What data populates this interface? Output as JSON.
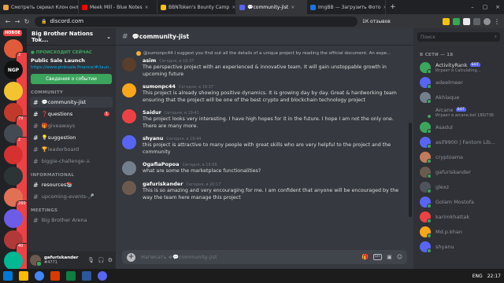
{
  "browser": {
    "tabs": [
      {
        "title": "Смотреть сериал Клон онл",
        "color": "#e8a33d",
        "active": false
      },
      {
        "title": "Meek Mill - Blue Notes",
        "color": "#ff0000",
        "active": false
      },
      {
        "title": "BBNToken's Bounty Camp",
        "color": "#f4c20d",
        "active": false
      },
      {
        "title": "💬community-jist",
        "color": "#5865f2",
        "active": true
      },
      {
        "title": "ImgBB — Загрузить Фото",
        "color": "#1a73e8",
        "active": false
      }
    ],
    "url": "discord.com",
    "reviews": "1К отзывов"
  },
  "guilds": {
    "new_label": "НОВОЕ",
    "items": [
      {
        "label": "",
        "color": "#e15b3a",
        "badge": "2"
      },
      {
        "label": "NGP",
        "color": "#111111",
        "badge": ""
      },
      {
        "label": "",
        "color": "#f4c430",
        "badge": ""
      },
      {
        "label": "",
        "color": "#c0392b",
        "badge": "79"
      },
      {
        "label": "",
        "color": "#444a52",
        "badge": "2"
      },
      {
        "label": "",
        "color": "#d63031",
        "badge": ""
      },
      {
        "label": "",
        "color": "#2d3436",
        "badge": ""
      },
      {
        "label": "",
        "color": "#e17055",
        "badge": "280"
      },
      {
        "label": "",
        "color": "#6c5ce7",
        "badge": ""
      },
      {
        "label": "",
        "color": "#b33939",
        "badge": "40"
      },
      {
        "label": "",
        "color": "#00b894",
        "badge": ""
      }
    ]
  },
  "server": {
    "name": "Big Brother Nations Tok...",
    "event": {
      "live": "● ПРОИСХОДИТ СЕЙЧАС",
      "title": "Public Sale Launch",
      "link": "https://www.pinksale.finance/#/laun...",
      "button": "Сведения о событии"
    },
    "categories": [
      {
        "name": "COMMUNITY",
        "channels": [
          {
            "name": "💬community-jist",
            "state": "active",
            "badge": ""
          },
          {
            "name": "❓questions",
            "state": "unread",
            "badge": "1"
          },
          {
            "name": "🎁giveaways",
            "state": "normal",
            "badge": ""
          },
          {
            "name": "💡suggestion",
            "state": "unread",
            "badge": ""
          },
          {
            "name": "🏆leaderboard",
            "state": "normal",
            "badge": ""
          },
          {
            "name": "biggie-challenge-⚔",
            "state": "normal",
            "badge": ""
          }
        ]
      },
      {
        "name": "INFORMATIONAL",
        "channels": [
          {
            "name": "resources📚",
            "state": "unread",
            "badge": ""
          },
          {
            "name": "upcoming-events-🎤",
            "state": "normal",
            "badge": ""
          }
        ]
      },
      {
        "name": "MEETINGS",
        "channels": [
          {
            "name": "Big Brother Arena",
            "state": "normal",
            "badge": ""
          }
        ]
      }
    ]
  },
  "user": {
    "name": "gafuriskander",
    "tag": "#4771"
  },
  "chat": {
    "channel": "💬community-jist",
    "reply_preview": "@sumonpc44 I suggest you find out all the details of a unique project by reading the official document. An expe...",
    "messages": [
      {
        "author": "asim",
        "time": "Сегодня, в 19:37",
        "color": "#5a3d2b",
        "text": "The perspective project with an experienced & innovative team. It will gain unstoppable growth in upcoming future"
      },
      {
        "author": "sumonpc44",
        "time": "Сегодня, в 19:37",
        "color": "#faa61a",
        "text": "This project is already showing positive dynamics. It is growing day by day. Great & hardworking team ensuring that the project will be one of the best crypto and blockchain technology project"
      },
      {
        "author": "Saidur",
        "time": "Сегодня, в 19:41",
        "color": "#ed4245",
        "text": "The project looks very interesting. I have high hopes for it in the future. I hope I am not the only one. There are many more."
      },
      {
        "author": "shyanu",
        "time": "Сегодня, в 19:44",
        "color": "#5865f2",
        "text": "this project is attractive to many people with great skills who are very helpful to the project and the community"
      },
      {
        "author": "OgafiaPopoa",
        "time": "Сегодня, в 19:56",
        "color": "#747f8d",
        "text": "what are some the marketplace functionalities?"
      },
      {
        "author": "gafuriskander",
        "time": "Сегодня, в 20:17",
        "color": "#6b5b4e",
        "text": "This is so amazing and very encouraging for me. I am confident that anyone will be encouraged by the way the team here manage this project"
      }
    ],
    "composer_placeholder": "Написать #💬community-jist"
  },
  "members": {
    "search_placeholder": "Поиск",
    "category": "В СЕТИ — 18",
    "items": [
      {
        "name": "ActivityRank",
        "bot": "БОТ",
        "status": "Играет в Calculating...",
        "color": "#3ba55d"
      },
      {
        "name": "adeelmeer",
        "bot": "",
        "status": "",
        "color": "#5865f2"
      },
      {
        "name": "Akhlaque",
        "bot": "",
        "status": "",
        "color": "#747f8d"
      },
      {
        "name": "Arcane",
        "bot": "БОТ",
        "status": "Играет в arcane.bot 180/736",
        "color": "#2f3136"
      },
      {
        "name": "Asadul",
        "bot": "",
        "status": "",
        "color": "#3ba55d"
      },
      {
        "name": "asif9900 | Fantom Lib...",
        "bot": "",
        "status": "",
        "color": "#5865f2"
      },
      {
        "name": "cryptoama",
        "bot": "",
        "status": "",
        "color": "#c27c5b"
      },
      {
        "name": "gafuriskander",
        "bot": "",
        "status": "",
        "color": "#6b5b4e"
      },
      {
        "name": "glexz",
        "bot": "",
        "status": "",
        "color": "#4f545c"
      },
      {
        "name": "Golam Mostofa",
        "bot": "",
        "status": "",
        "color": "#5865f2"
      },
      {
        "name": "karimkhattak",
        "bot": "",
        "status": "",
        "color": "#ed4245"
      },
      {
        "name": "Md.p.khan",
        "bot": "",
        "status": "",
        "color": "#faa61a"
      },
      {
        "name": "shyanu",
        "bot": "",
        "status": "",
        "color": "#5865f2"
      }
    ]
  },
  "taskbar": {
    "lang": "ENG",
    "time": "22:17"
  }
}
